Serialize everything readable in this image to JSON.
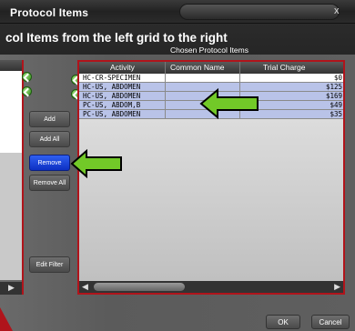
{
  "window": {
    "title": "Protocol Items",
    "close_glyph": "x"
  },
  "header": {
    "instruction": "col Items from the left grid to the right",
    "chosen_label": "Chosen Protocol Items"
  },
  "buttons": {
    "add": "Add",
    "add_all": "Add All",
    "remove": "Remove",
    "remove_all": "Remove All",
    "edit_filter": "Edit Filter",
    "ok": "OK",
    "cancel": "Cancel"
  },
  "grid": {
    "columns": [
      "Activity",
      "Common Name",
      "Trial Charge"
    ],
    "rows": [
      {
        "activity": "HC-CR-SPECIMEN",
        "common_name": "",
        "trial_charge": "$0",
        "selected": false
      },
      {
        "activity": "HC-US, ABDOMEN",
        "common_name": "",
        "trial_charge": "$125",
        "selected": true
      },
      {
        "activity": "HC-US, ABDOMEN",
        "common_name": "",
        "trial_charge": "$169",
        "selected": true
      },
      {
        "activity": "PC-US, ABDOM,B",
        "common_name": "",
        "trial_charge": "$49",
        "selected": true
      },
      {
        "activity": "PC-US, ABDOMEN",
        "common_name": "",
        "trial_charge": "$35",
        "selected": true
      }
    ]
  },
  "icons": {
    "move_right": "green-check-circle",
    "annotation": "green-arrow"
  },
  "colors": {
    "accent_red": "#b0141b",
    "selected_row": "#b9c3e8",
    "remove_button": "#0d2fc2",
    "annotation_green": "#72c928"
  }
}
